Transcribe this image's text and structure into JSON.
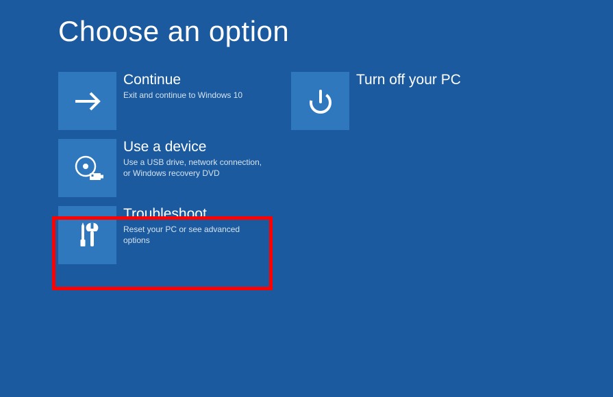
{
  "title": "Choose an option",
  "options": {
    "continue": {
      "title": "Continue",
      "desc": "Exit and continue to Windows 10"
    },
    "useDevice": {
      "title": "Use a device",
      "desc": "Use a USB drive, network connection, or Windows recovery DVD"
    },
    "troubleshoot": {
      "title": "Troubleshoot",
      "desc": "Reset your PC or see advanced options"
    },
    "turnOff": {
      "title": "Turn off your PC",
      "desc": ""
    }
  },
  "highlight": {
    "target": "troubleshoot"
  }
}
